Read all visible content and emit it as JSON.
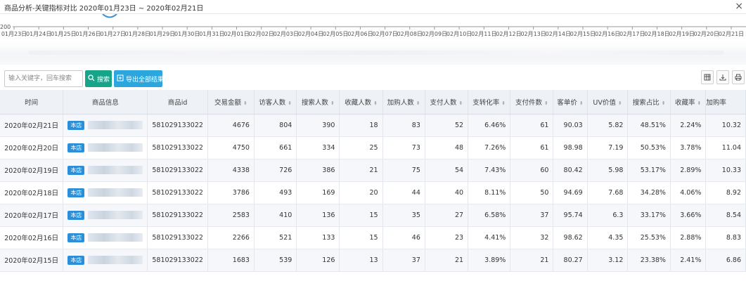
{
  "window": {
    "title": "商品分析-关键指标对比 2020年01月23日 ~ 2020年02月21日",
    "close_glyph": "×"
  },
  "chart_data": {
    "type": "line",
    "x": [
      "01月23日",
      "01月24日",
      "01月25日",
      "01月26日",
      "01月27日",
      "01月28日",
      "01月29日",
      "01月30日",
      "01月31日",
      "02月01日",
      "02月02日",
      "02月03日",
      "02月04日",
      "02月05日",
      "02月06日",
      "02月07日",
      "02月08日",
      "02月09日",
      "02月10日",
      "02月11日",
      "02月12日",
      "02月13日",
      "02月14日",
      "02月15日",
      "02月16日",
      "02月17日",
      "02月18日",
      "02月19日",
      "02月20日",
      "02月21日"
    ],
    "ytick_visible": "200"
  },
  "toolbar": {
    "search_placeholder": "输入关键字，回车搜索",
    "search_label": "搜索",
    "export_label": "导出全部结果",
    "search_icon": "search-icon",
    "export_icon": "export-icon",
    "tools": [
      "columns-icon",
      "export-icon",
      "print-icon"
    ]
  },
  "table": {
    "columns": [
      "时间",
      "商品信息",
      "商品id",
      "交易金额",
      "访客人数",
      "搜索人数",
      "收藏人数",
      "加购人数",
      "支付人数",
      "支转化率",
      "支付件数",
      "客单价",
      "UV价值",
      "搜索占比",
      "收藏率",
      "加购率"
    ],
    "store_badge": "本店",
    "rows": [
      [
        "2020年02月21日",
        "581029133022",
        "4676",
        "804",
        "390",
        "18",
        "83",
        "52",
        "6.46%",
        "61",
        "90.03",
        "5.82",
        "48.51%",
        "2.24%",
        "10.32"
      ],
      [
        "2020年02月20日",
        "581029133022",
        "4750",
        "661",
        "334",
        "25",
        "73",
        "48",
        "7.26%",
        "61",
        "98.98",
        "7.19",
        "50.53%",
        "3.78%",
        "11.04"
      ],
      [
        "2020年02月19日",
        "581029133022",
        "4338",
        "726",
        "386",
        "21",
        "75",
        "54",
        "7.43%",
        "60",
        "80.42",
        "5.98",
        "53.17%",
        "2.89%",
        "10.33"
      ],
      [
        "2020年02月18日",
        "581029133022",
        "3786",
        "493",
        "169",
        "20",
        "44",
        "40",
        "8.11%",
        "50",
        "94.69",
        "7.68",
        "34.28%",
        "4.06%",
        "8.92"
      ],
      [
        "2020年02月17日",
        "581029133022",
        "2583",
        "410",
        "136",
        "15",
        "35",
        "27",
        "6.58%",
        "37",
        "95.74",
        "6.3",
        "33.17%",
        "3.66%",
        "8.54"
      ],
      [
        "2020年02月16日",
        "581029133022",
        "2266",
        "521",
        "133",
        "15",
        "46",
        "23",
        "4.41%",
        "32",
        "98.62",
        "4.35",
        "25.53%",
        "2.88%",
        "8.83"
      ],
      [
        "2020年02月15日",
        "581029133022",
        "1683",
        "539",
        "126",
        "13",
        "37",
        "21",
        "3.89%",
        "21",
        "80.27",
        "3.12",
        "23.38%",
        "2.41%",
        "6.86"
      ]
    ]
  }
}
